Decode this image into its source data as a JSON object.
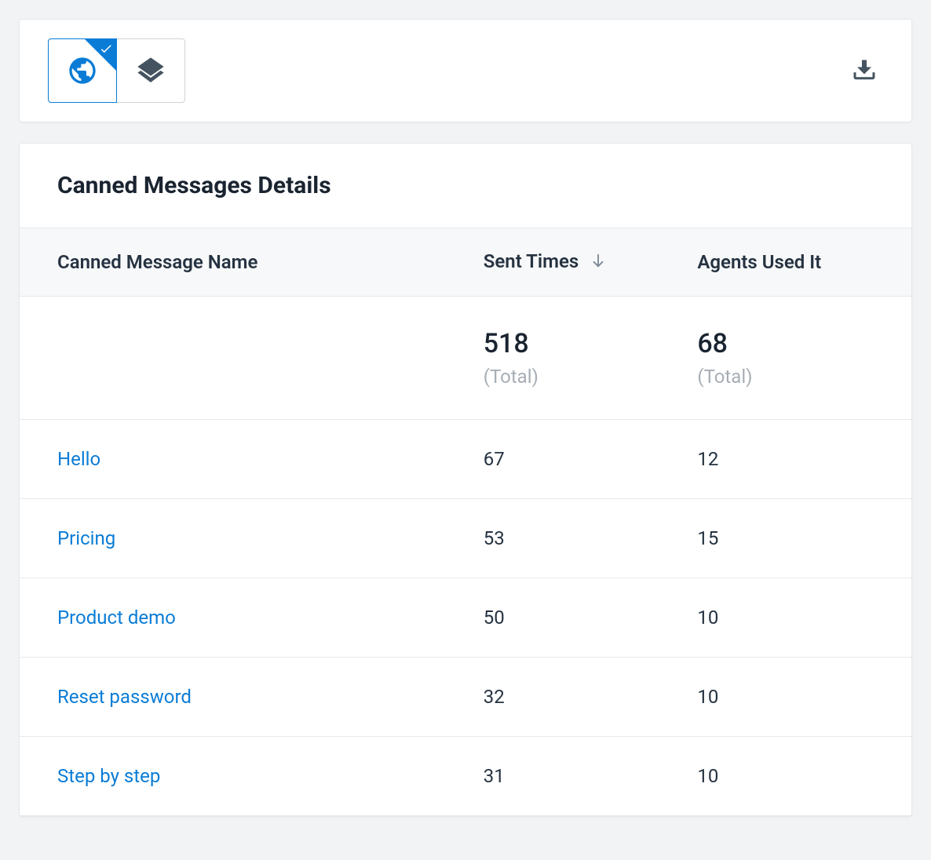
{
  "toolbar": {
    "globe_active": true
  },
  "details": {
    "title": "Canned Messages Details",
    "columns": {
      "name": "Canned Message Name",
      "sent": "Sent Times",
      "agents": "Agents Used It"
    },
    "totals": {
      "sent_value": "518",
      "sent_label": "(Total)",
      "agents_value": "68",
      "agents_label": "(Total)"
    },
    "rows": [
      {
        "name": "Hello",
        "sent": "67",
        "agents": "12"
      },
      {
        "name": "Pricing",
        "sent": "53",
        "agents": "15"
      },
      {
        "name": "Product demo",
        "sent": "50",
        "agents": "10"
      },
      {
        "name": "Reset password",
        "sent": "32",
        "agents": "10"
      },
      {
        "name": "Step by step",
        "sent": "31",
        "agents": "10"
      }
    ]
  }
}
